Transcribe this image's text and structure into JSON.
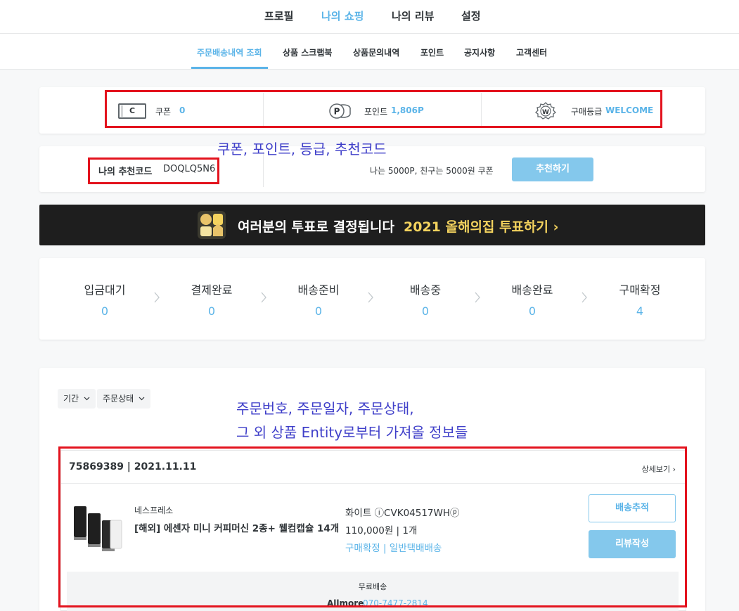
{
  "top_nav": {
    "items": [
      "프로필",
      "나의 쇼핑",
      "나의 리뷰",
      "설정"
    ],
    "active_index": 1
  },
  "sub_nav": {
    "items": [
      "주문배송내역 조회",
      "상품 스크랩북",
      "상품문의내역",
      "포인트",
      "공지사항",
      "고객센터"
    ],
    "active_index": 0
  },
  "summary": {
    "coupon_icon_letter": "C",
    "coupon_label": "쿠폰",
    "coupon_value": "0",
    "point_label": "포인트",
    "point_value": "1,806P",
    "grade_label": "구매등급",
    "grade_value": "WELCOME"
  },
  "recommend": {
    "title": "나의 추천코드",
    "code": "DOQLQ5N6",
    "description": "나는 5000P, 친구는 5000원 쿠폰",
    "button": "추천하기"
  },
  "banner": {
    "text": "여러분의 투표로 결정됩니다",
    "highlight": "2021 올해의집 투표하기 ›"
  },
  "order_status": {
    "steps": [
      {
        "label": "입금대기",
        "count": "0"
      },
      {
        "label": "결제완료",
        "count": "0"
      },
      {
        "label": "배송준비",
        "count": "0"
      },
      {
        "label": "배송중",
        "count": "0"
      },
      {
        "label": "배송완료",
        "count": "0"
      },
      {
        "label": "구매확정",
        "count": "4"
      }
    ]
  },
  "filters": {
    "period": "기간",
    "status": "주문상태"
  },
  "order": {
    "number_date": "75869389 | 2021.11.11",
    "detail_link": "상세보기 ›",
    "brand": "네스프레소",
    "product_name": "[해외] 에센자 미니 커피머신 2종+ 웰컴캡슐 14개",
    "option": "화이트 ⓘCVK04517WHⓟ",
    "price_qty": "110,000원 | 1개",
    "status": "구매확정 | 일반택배배송",
    "track_button": "배송추적",
    "review_button": "리뷰작성",
    "shipping_fee": "무료배송",
    "seller": "Allmore",
    "seller_phone": "070-7477-2814"
  },
  "annotations": {
    "summary_note": "쿠폰, 포인트, 등급, 추천코드",
    "order_note_line1": "주문번호, 주문일자, 주문상태,",
    "order_note_line2": "그 외 상품 Entity로부터 가져올 정보들"
  },
  "colors": {
    "accent": "#5bb4e8",
    "accent_light": "#84c8ec",
    "annotation_box": "#e3131e",
    "annotation_text": "#3f3fc9",
    "banner_bg": "#1e1e1e",
    "banner_highlight": "#f4d35e"
  }
}
